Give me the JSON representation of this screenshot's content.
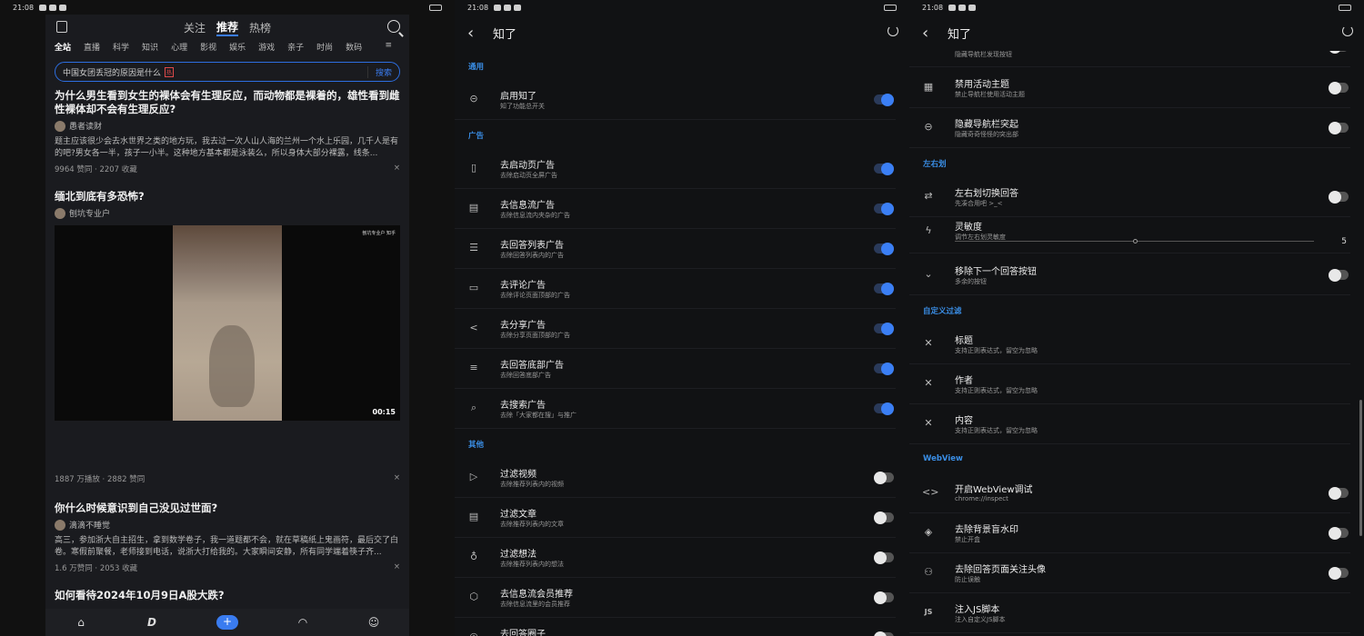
{
  "status": {
    "time": "21:08"
  },
  "feed_app": {
    "tabs": [
      "关注",
      "推荐",
      "热榜"
    ],
    "categories": [
      "全站",
      "直播",
      "科学",
      "知识",
      "心理",
      "影视",
      "娱乐",
      "游戏",
      "亲子",
      "时尚",
      "数码"
    ],
    "search": {
      "query": "中国女团丢冠的原因是什么",
      "hot_badge": "热",
      "button": "搜索"
    },
    "items": [
      {
        "title": "为什么男生看到女生的裸体会有生理反应，而动物都是裸着的，雄性看到雌性裸体却不会有生理反应?",
        "author": "愚者读财",
        "excerpt": "题主应该很少会去水世界之类的地方玩，我去过一次人山人海的兰州一个水上乐园，几千人是有的吧?男女各一半，孩子一小半。这种地方基本都是泳装么，所以身体大部分裸露，线条...",
        "meta": "9964 赞同 · 2207 收藏"
      },
      {
        "title": "缅北到底有多恐怖?",
        "author": "刨坑专业户",
        "video_duration": "00:15",
        "video_watermark": "刨坑专业户 知乎",
        "meta": "1887 万播放 · 2882 赞同"
      },
      {
        "title": "你什么时候意识到自己没见过世面?",
        "author": "滴滴不睡觉",
        "excerpt": "高三，参加浙大自主招生，拿到数学卷子，我一道题都不会，就在草稿纸上鬼画符，最后交了白卷。寒假前聚餐，老师接到电话，说浙大打给我的。大家瞬间安静，所有同学端着筷子齐...",
        "meta": "1.6 万赞同 · 2053 收藏"
      },
      {
        "title": "如何看待2024年10月9日A股大跌?"
      }
    ],
    "close_glyph": "×"
  },
  "settings": {
    "title": "知了",
    "sections": {
      "general": "通用",
      "ads": "广告",
      "other": "其他",
      "swipe": "左右划",
      "custom_filter": "自定义过滤",
      "webview": "WebView"
    },
    "general_rows": [
      {
        "title": "启用知了",
        "sub": "知了功能总开关",
        "on": true
      }
    ],
    "ad_rows": [
      {
        "title": "去启动页广告",
        "sub": "去除启动页全屏广告",
        "on": true
      },
      {
        "title": "去信息流广告",
        "sub": "去除信息流内夹杂的广告",
        "on": true
      },
      {
        "title": "去回答列表广告",
        "sub": "去除回答列表内的广告",
        "on": true
      },
      {
        "title": "去评论广告",
        "sub": "去除评论页面顶部的广告",
        "on": true
      },
      {
        "title": "去分享广告",
        "sub": "去除分享页面顶部的广告",
        "on": true
      },
      {
        "title": "去回答底部广告",
        "sub": "去除回答底部广告",
        "on": true
      },
      {
        "title": "去搜索广告",
        "sub": "去除「大家都在搜」与推广",
        "on": true
      }
    ],
    "other_rows": [
      {
        "title": "过滤视频",
        "sub": "去除推荐列表内的视频",
        "on": false
      },
      {
        "title": "过滤文章",
        "sub": "去除推荐列表内的文章",
        "on": false
      },
      {
        "title": "过滤想法",
        "sub": "去除推荐列表内的想法",
        "on": false
      },
      {
        "title": "去信息流会员推荐",
        "sub": "去除信息流里的会员推荐",
        "on": false
      },
      {
        "title": "去回答圈子",
        "sub": "",
        "on": false
      }
    ],
    "p3_partial_sub": "隐藏导航栏发现按钮",
    "nav_rows": [
      {
        "title": "禁用活动主题",
        "sub": "禁止导航栏使用活动主题",
        "on": false
      },
      {
        "title": "隐藏导航栏突起",
        "sub": "隐藏奇奇怪怪的突出部",
        "on": false
      }
    ],
    "swipe_rows": [
      {
        "title": "左右划切换回答",
        "sub": "先凑合用吧 >_<",
        "on": false
      },
      {
        "title": "灵敏度",
        "sub": "调节左右划灵敏度",
        "slider_value": "5",
        "slider_fraction": 0.5
      },
      {
        "title": "移除下一个回答按钮",
        "sub": "多余的按钮",
        "on": false
      }
    ],
    "filter_rows": [
      {
        "title": "标题",
        "sub": "支持正则表达式，留空为忽略"
      },
      {
        "title": "作者",
        "sub": "支持正则表达式，留空为忽略"
      },
      {
        "title": "内容",
        "sub": "支持正则表达式，留空为忽略"
      }
    ],
    "webview_rows": [
      {
        "title": "开启WebView调试",
        "sub": "chrome://inspect",
        "on": false
      },
      {
        "title": "去除背景盲水印",
        "sub": "禁止开盒",
        "on": false
      },
      {
        "title": "去除回答页面关注头像",
        "sub": "防止误触",
        "on": false
      },
      {
        "title": "注入JS脚本",
        "sub": "注入自定义JS脚本"
      }
    ],
    "js_icon_text": "JS"
  }
}
